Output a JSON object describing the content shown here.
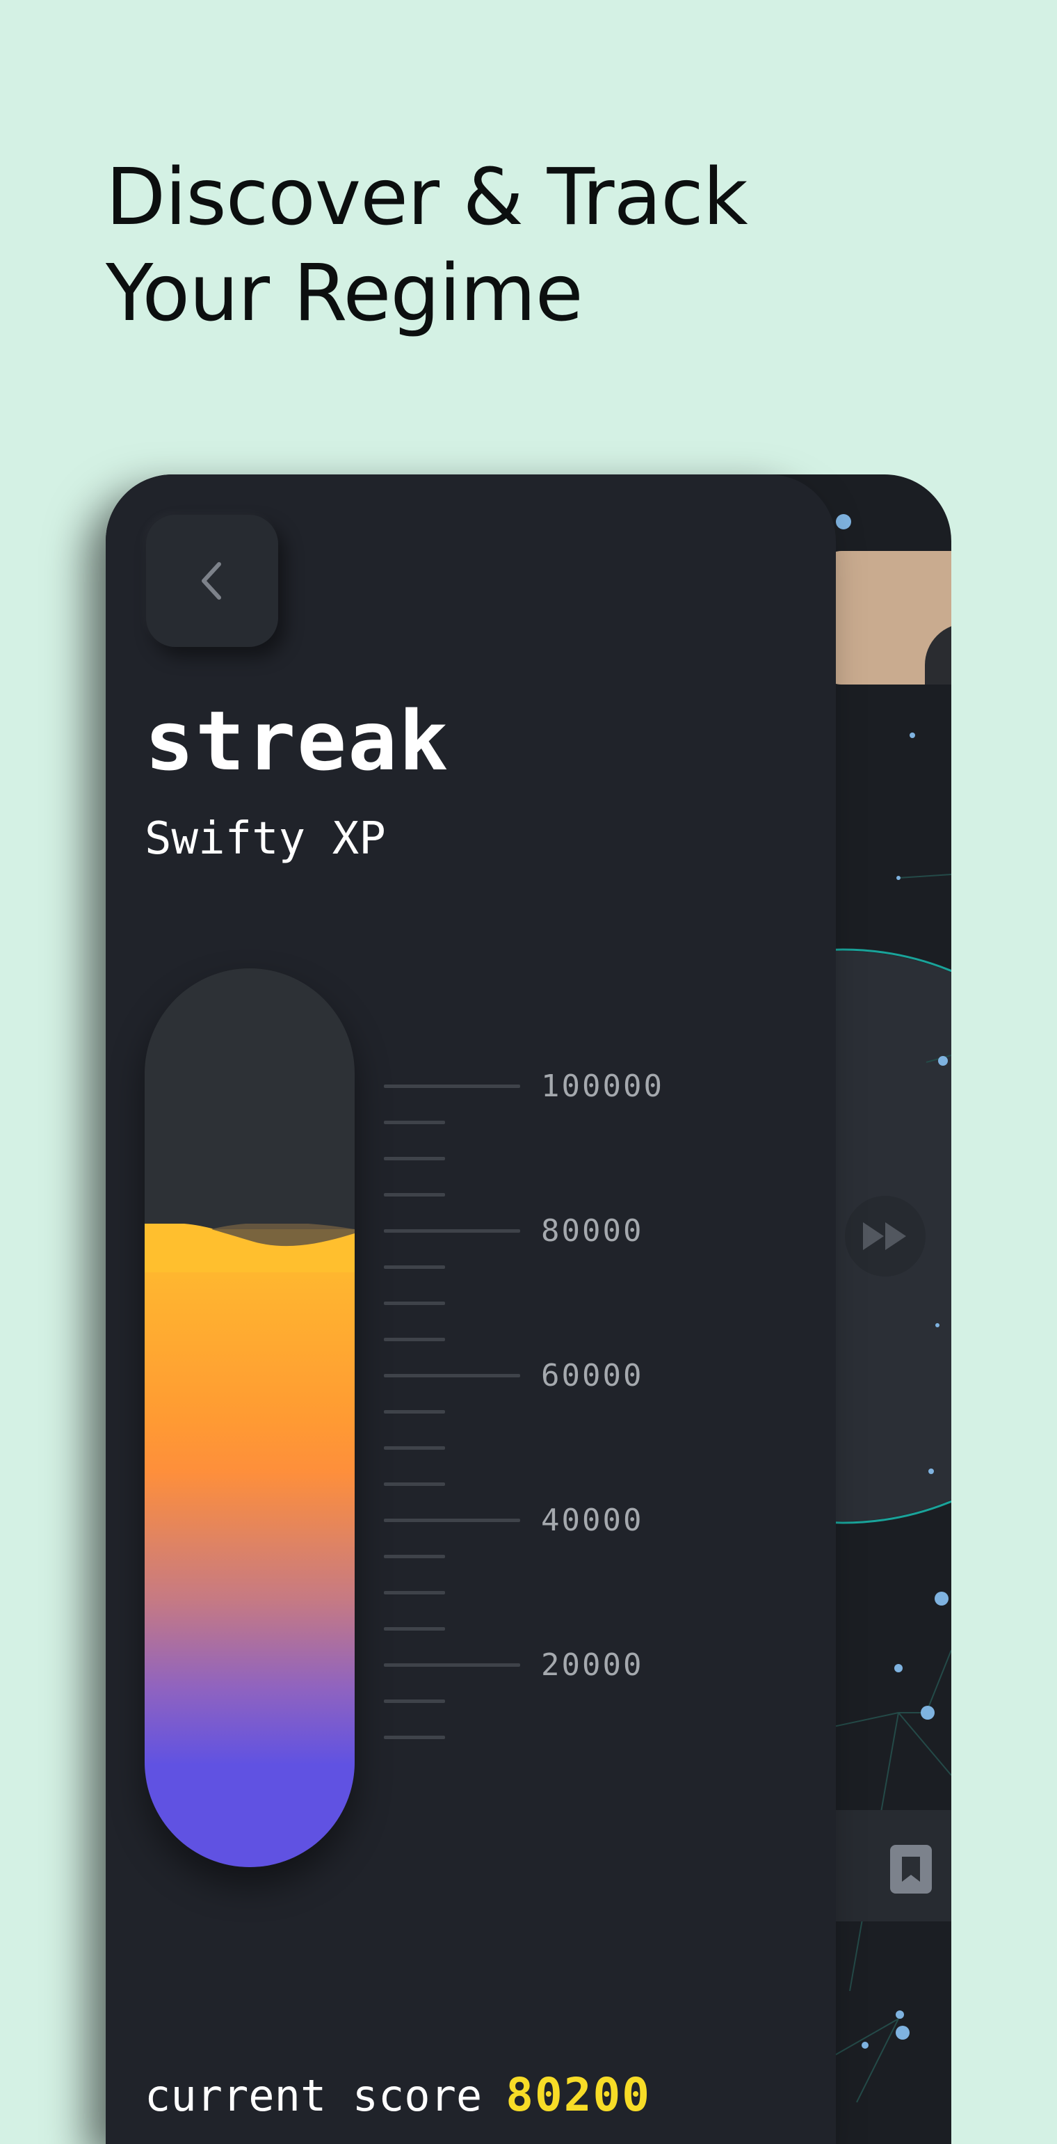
{
  "promo": {
    "headline_line1": "Discover & Track",
    "headline_line2": "Your Regime"
  },
  "card": {
    "back_icon": "chevron-left-icon",
    "title": "streak",
    "subtitle": "Swifty XP",
    "progress": {
      "current": 80200,
      "max": 100000,
      "fill_fraction": 0.802,
      "gradient_colors": [
        "#ffbf2e",
        "#fe8f3b",
        "#6052e2"
      ],
      "scale_labels": [
        "100000",
        "80000",
        "60000",
        "40000",
        "20000"
      ]
    },
    "score_label": "current score",
    "score_value": "80200",
    "score_color": "#f7dc27"
  },
  "background_screen": {
    "avatar": "profile-photo",
    "controls": [
      "fast-forward-icon",
      "bookmark-icon"
    ]
  },
  "colors": {
    "background": "#d4f1e4",
    "card": "#20232a",
    "accent_teal": "#1aa39a"
  }
}
